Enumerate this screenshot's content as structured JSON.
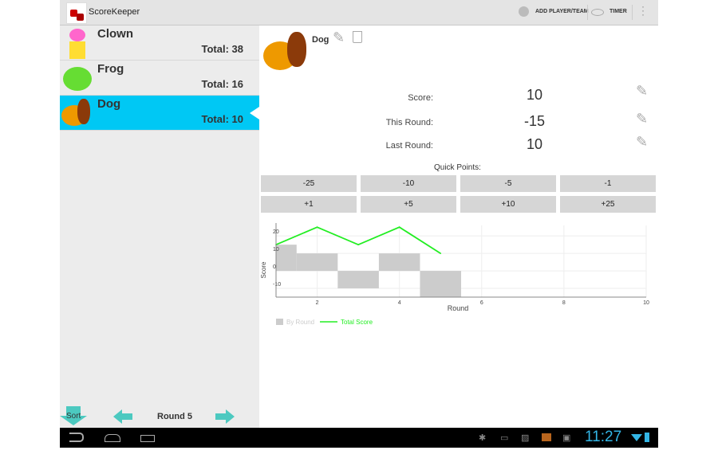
{
  "app": {
    "title": "ScoreKeeper"
  },
  "actionbar": {
    "add_player": "ADD PLAYER/TEAM",
    "timer": "TIMER"
  },
  "players": [
    {
      "name": "Clown",
      "total": "Total: 38"
    },
    {
      "name": "Frog",
      "total": "Total: 16"
    },
    {
      "name": "Dog",
      "total": "Total: 10",
      "selected": true
    }
  ],
  "detail": {
    "name": "Dog",
    "score_label": "Score:",
    "score": "10",
    "this_round_label": "This Round:",
    "this_round": "-15",
    "last_round_label": "Last Round:",
    "last_round": "10",
    "quick_points_label": "Quick Points:",
    "quick_points": [
      "-25",
      "-10",
      "-5",
      "-1",
      "+1",
      "+5",
      "+10",
      "+25"
    ]
  },
  "footer": {
    "sort": "Sort",
    "round": "Round 5"
  },
  "statusbar": {
    "time": "11:27"
  },
  "colors": {
    "accent": "#00c8f4",
    "line": "#22ee22",
    "bar": "#cccccc",
    "clock": "#33b5e5"
  },
  "chart_data": {
    "type": "bar+line",
    "xlabel": "Round",
    "ylabel": "Score",
    "x_ticks": [
      "2",
      "4",
      "6",
      "8",
      "10"
    ],
    "y_ticks": [
      "20",
      "10",
      "0",
      "-10"
    ],
    "xlim": [
      1,
      10
    ],
    "ylim": [
      -15,
      26
    ],
    "grid": true,
    "legend": "bottom-left",
    "categories": [
      1,
      2,
      3,
      4,
      5
    ],
    "series": [
      {
        "name": "By Round",
        "type": "bar",
        "values": [
          15,
          10,
          -10,
          10,
          -15
        ]
      },
      {
        "name": "Total Score",
        "type": "line",
        "values": [
          15,
          25,
          15,
          25,
          10
        ]
      }
    ]
  }
}
